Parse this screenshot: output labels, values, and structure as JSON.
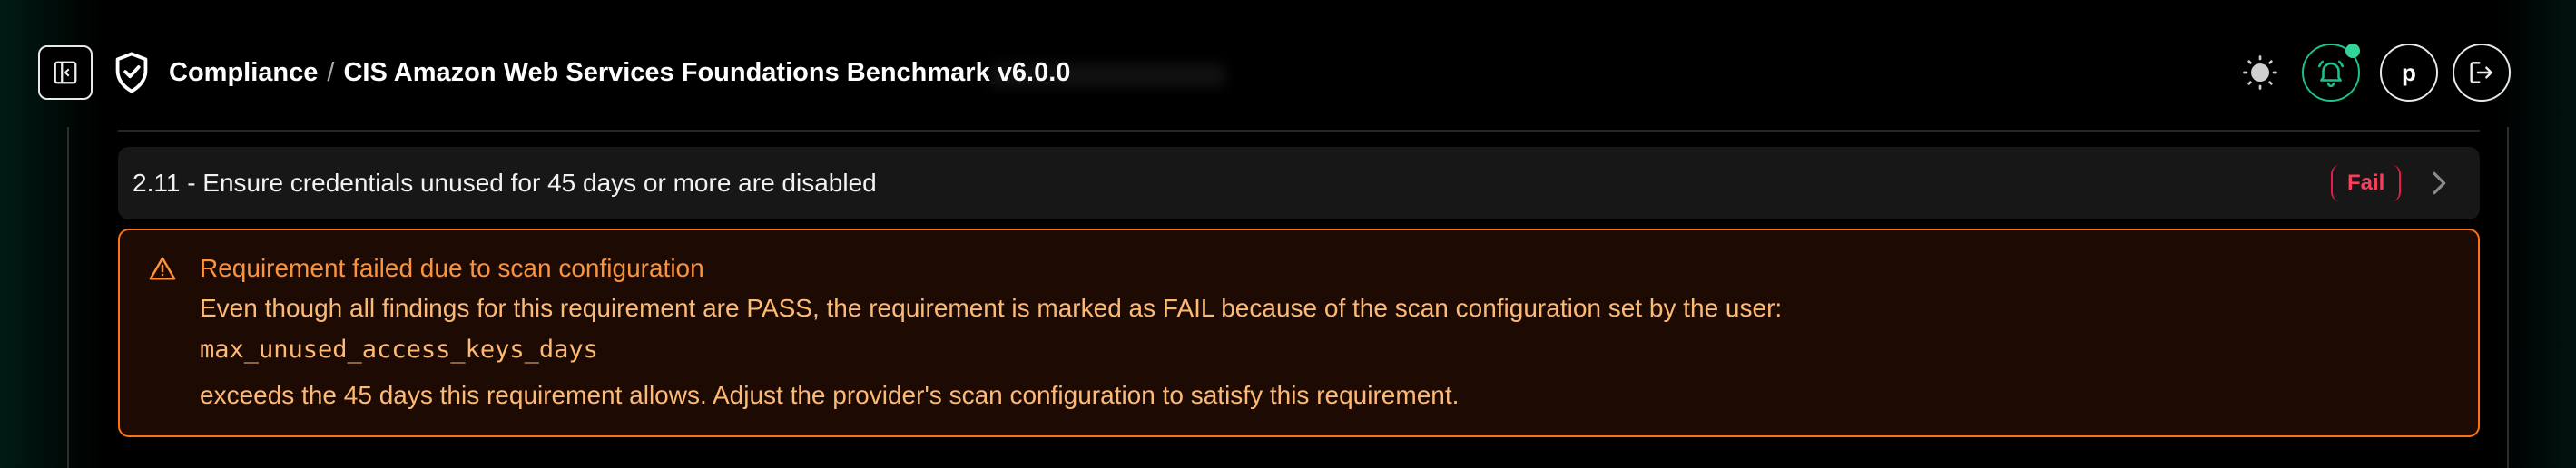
{
  "header": {
    "breadcrumb_root": "Compliance",
    "breadcrumb_separator": "/",
    "breadcrumb_current": "CIS Amazon Web Services Foundations Benchmark v6.0.0",
    "avatar_initial": "p",
    "icons": {
      "sidebar_toggle": "sidebar-toggle-icon",
      "shield": "shield-check-icon",
      "theme": "sun-icon",
      "notifications": "bell-icon",
      "logout": "logout-icon"
    },
    "notification_dot_color": "#34d399"
  },
  "requirement": {
    "title": "2.11 - Ensure credentials unused for 45 days or more are disabled",
    "status": "Fail",
    "status_color": "#f43f5e"
  },
  "warning": {
    "title": "Requirement failed due to scan configuration",
    "line1": "Even though all findings for this requirement are PASS, the requirement is marked as FAIL because of the scan configuration set by the user:",
    "config_key": "max_unused_access_keys_days",
    "line2": "exceeds the 45 days this requirement allows. Adjust the provider's scan configuration to satisfy this requirement.",
    "accent_color": "#f97316"
  }
}
